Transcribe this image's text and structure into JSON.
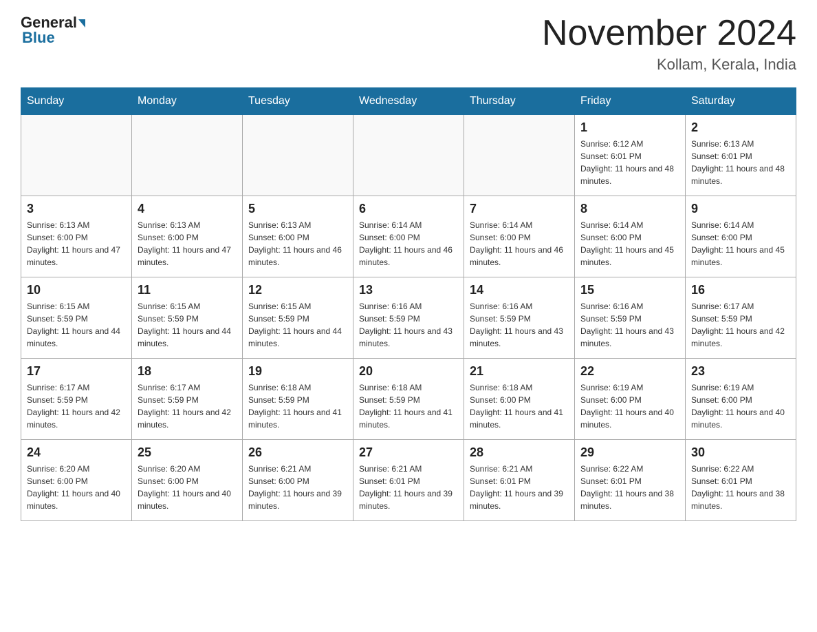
{
  "header": {
    "logo_general": "General",
    "logo_blue": "Blue",
    "month_title": "November 2024",
    "location": "Kollam, Kerala, India"
  },
  "days_of_week": [
    "Sunday",
    "Monday",
    "Tuesday",
    "Wednesday",
    "Thursday",
    "Friday",
    "Saturday"
  ],
  "weeks": [
    [
      {
        "day": "",
        "info": ""
      },
      {
        "day": "",
        "info": ""
      },
      {
        "day": "",
        "info": ""
      },
      {
        "day": "",
        "info": ""
      },
      {
        "day": "",
        "info": ""
      },
      {
        "day": "1",
        "info": "Sunrise: 6:12 AM\nSunset: 6:01 PM\nDaylight: 11 hours and 48 minutes."
      },
      {
        "day": "2",
        "info": "Sunrise: 6:13 AM\nSunset: 6:01 PM\nDaylight: 11 hours and 48 minutes."
      }
    ],
    [
      {
        "day": "3",
        "info": "Sunrise: 6:13 AM\nSunset: 6:00 PM\nDaylight: 11 hours and 47 minutes."
      },
      {
        "day": "4",
        "info": "Sunrise: 6:13 AM\nSunset: 6:00 PM\nDaylight: 11 hours and 47 minutes."
      },
      {
        "day": "5",
        "info": "Sunrise: 6:13 AM\nSunset: 6:00 PM\nDaylight: 11 hours and 46 minutes."
      },
      {
        "day": "6",
        "info": "Sunrise: 6:14 AM\nSunset: 6:00 PM\nDaylight: 11 hours and 46 minutes."
      },
      {
        "day": "7",
        "info": "Sunrise: 6:14 AM\nSunset: 6:00 PM\nDaylight: 11 hours and 46 minutes."
      },
      {
        "day": "8",
        "info": "Sunrise: 6:14 AM\nSunset: 6:00 PM\nDaylight: 11 hours and 45 minutes."
      },
      {
        "day": "9",
        "info": "Sunrise: 6:14 AM\nSunset: 6:00 PM\nDaylight: 11 hours and 45 minutes."
      }
    ],
    [
      {
        "day": "10",
        "info": "Sunrise: 6:15 AM\nSunset: 5:59 PM\nDaylight: 11 hours and 44 minutes."
      },
      {
        "day": "11",
        "info": "Sunrise: 6:15 AM\nSunset: 5:59 PM\nDaylight: 11 hours and 44 minutes."
      },
      {
        "day": "12",
        "info": "Sunrise: 6:15 AM\nSunset: 5:59 PM\nDaylight: 11 hours and 44 minutes."
      },
      {
        "day": "13",
        "info": "Sunrise: 6:16 AM\nSunset: 5:59 PM\nDaylight: 11 hours and 43 minutes."
      },
      {
        "day": "14",
        "info": "Sunrise: 6:16 AM\nSunset: 5:59 PM\nDaylight: 11 hours and 43 minutes."
      },
      {
        "day": "15",
        "info": "Sunrise: 6:16 AM\nSunset: 5:59 PM\nDaylight: 11 hours and 43 minutes."
      },
      {
        "day": "16",
        "info": "Sunrise: 6:17 AM\nSunset: 5:59 PM\nDaylight: 11 hours and 42 minutes."
      }
    ],
    [
      {
        "day": "17",
        "info": "Sunrise: 6:17 AM\nSunset: 5:59 PM\nDaylight: 11 hours and 42 minutes."
      },
      {
        "day": "18",
        "info": "Sunrise: 6:17 AM\nSunset: 5:59 PM\nDaylight: 11 hours and 42 minutes."
      },
      {
        "day": "19",
        "info": "Sunrise: 6:18 AM\nSunset: 5:59 PM\nDaylight: 11 hours and 41 minutes."
      },
      {
        "day": "20",
        "info": "Sunrise: 6:18 AM\nSunset: 5:59 PM\nDaylight: 11 hours and 41 minutes."
      },
      {
        "day": "21",
        "info": "Sunrise: 6:18 AM\nSunset: 6:00 PM\nDaylight: 11 hours and 41 minutes."
      },
      {
        "day": "22",
        "info": "Sunrise: 6:19 AM\nSunset: 6:00 PM\nDaylight: 11 hours and 40 minutes."
      },
      {
        "day": "23",
        "info": "Sunrise: 6:19 AM\nSunset: 6:00 PM\nDaylight: 11 hours and 40 minutes."
      }
    ],
    [
      {
        "day": "24",
        "info": "Sunrise: 6:20 AM\nSunset: 6:00 PM\nDaylight: 11 hours and 40 minutes."
      },
      {
        "day": "25",
        "info": "Sunrise: 6:20 AM\nSunset: 6:00 PM\nDaylight: 11 hours and 40 minutes."
      },
      {
        "day": "26",
        "info": "Sunrise: 6:21 AM\nSunset: 6:00 PM\nDaylight: 11 hours and 39 minutes."
      },
      {
        "day": "27",
        "info": "Sunrise: 6:21 AM\nSunset: 6:01 PM\nDaylight: 11 hours and 39 minutes."
      },
      {
        "day": "28",
        "info": "Sunrise: 6:21 AM\nSunset: 6:01 PM\nDaylight: 11 hours and 39 minutes."
      },
      {
        "day": "29",
        "info": "Sunrise: 6:22 AM\nSunset: 6:01 PM\nDaylight: 11 hours and 38 minutes."
      },
      {
        "day": "30",
        "info": "Sunrise: 6:22 AM\nSunset: 6:01 PM\nDaylight: 11 hours and 38 minutes."
      }
    ]
  ]
}
